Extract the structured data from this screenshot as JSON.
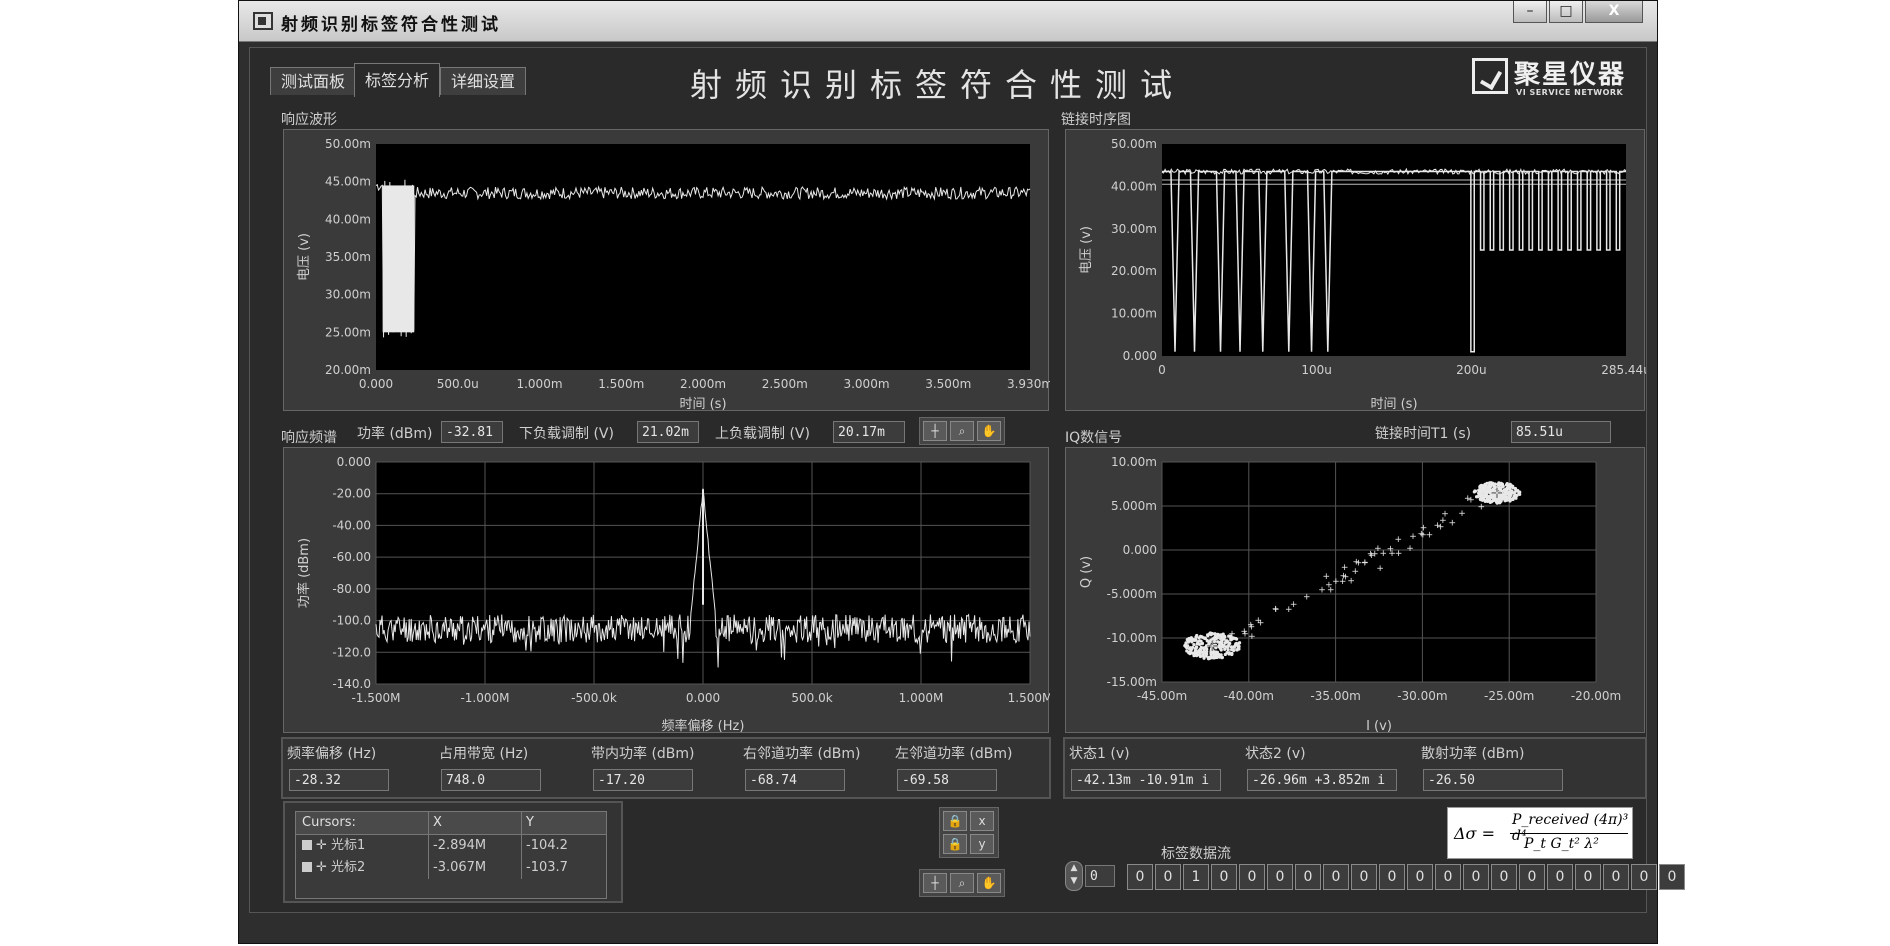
{
  "window": {
    "title": "射频识别标签符合性测试",
    "minimize_label": "–",
    "maximize_label": "□",
    "close_label": "X"
  },
  "tabs": [
    {
      "label": "测试面板",
      "active": false
    },
    {
      "label": "标签分析",
      "active": true
    },
    {
      "label": "详细设置",
      "active": false
    }
  ],
  "main_title": "射频识别标签符合性测试",
  "logo": {
    "text": "聚星仪器",
    "subtext": "VI SERVICE NETWORK"
  },
  "response_waveform": {
    "label": "响应波形",
    "chart_data": {
      "type": "line",
      "xlabel": "时间 (s)",
      "ylabel": "电压 (v)",
      "xlim": [
        0,
        0.00393
      ],
      "ylim": [
        0.02,
        0.05
      ],
      "x_ticks": [
        "0.000",
        "500.0u",
        "1.000m",
        "1.500m",
        "2.000m",
        "2.500m",
        "3.000m",
        "3.500m",
        "3.930m"
      ],
      "y_ticks": [
        "50.00m",
        "45.00m",
        "40.00m",
        "35.00m",
        "30.00m",
        "25.00m",
        "20.00m"
      ],
      "series": [
        {
          "x": [
            0,
            4e-05,
            4e-05,
            0.00023,
            0.00023,
            0.00393
          ],
          "y": [
            0.0445,
            0.0445,
            0.025,
            0.025,
            0.0435,
            0.0435
          ]
        }
      ],
      "grid": false
    }
  },
  "link_timing": {
    "label": "链接时序图",
    "chart_data": {
      "type": "line",
      "xlabel": "时间 (s)",
      "ylabel": "电压 (v)",
      "xlim": [
        0,
        0.00028544
      ],
      "ylim": [
        0,
        0.05
      ],
      "x_ticks": [
        "0",
        "100u",
        "200u",
        "285.44u"
      ],
      "y_ticks": [
        "50.00m",
        "40.00m",
        "30.00m",
        "20.00m",
        "10.00m",
        "0.000"
      ],
      "high_level": 0.0435,
      "reference_lines": [
        0.0415,
        0.0405
      ],
      "dip_times": [
        8e-06,
        2e-05,
        3.6e-05,
        4.8e-05,
        6.2e-05,
        7.8e-05,
        9.2e-05,
        0.000102
      ],
      "dip_level": 0.001,
      "burst_start": 0.00019,
      "burst_count": 16,
      "burst_low": 0.025,
      "grid": false
    }
  },
  "spectrum": {
    "label": "响应频谱",
    "chart_data": {
      "type": "line",
      "xlabel": "频率偏移 (Hz)",
      "ylabel": "功率 (dBm)",
      "xlim": [
        -1500000,
        1500000
      ],
      "ylim": [
        -140,
        0
      ],
      "x_ticks": [
        "-1.500M",
        "-1.000M",
        "-500.0k",
        "0.000",
        "500.0k",
        "1.000M",
        "1.500M"
      ],
      "y_ticks": [
        "0.000",
        "-20.00",
        "-40.00",
        "-60.00",
        "-80.00",
        "-100.0",
        "-120.0",
        "-140.0"
      ],
      "noise_floor": -105,
      "peak": {
        "x": 0,
        "y": -17.2
      },
      "grid": true
    }
  },
  "iq": {
    "label": "IQ数信号",
    "chart_data": {
      "type": "scatter",
      "xlabel": "I (v)",
      "ylabel": "Q (v)",
      "xlim": [
        -0.045,
        -0.02
      ],
      "ylim": [
        -0.015,
        0.01
      ],
      "x_ticks": [
        "-45.00m",
        "-40.00m",
        "-35.00m",
        "-30.00m",
        "-25.00m",
        "-20.00m"
      ],
      "y_ticks": [
        "10.00m",
        "5.000m",
        "0.000",
        "-5.000m",
        "-10.00m",
        "-15.00m"
      ],
      "clusters": [
        {
          "center": [
            -0.0421,
            -0.0109
          ],
          "spread": 0.0015
        },
        {
          "center": [
            -0.0257,
            0.0065
          ],
          "spread": 0.0012
        }
      ],
      "grid": true
    }
  },
  "spectrum_measurements": {
    "power_label": "功率 (dBm)",
    "power_value": "-32.81",
    "lower_mod_label": "下负载调制 (V)",
    "lower_mod_value": "21.02m",
    "upper_mod_label": "上负载调制 (V)",
    "upper_mod_value": "20.17m"
  },
  "link_time": {
    "label": "链接时间T1 (s)",
    "value": "85.51u"
  },
  "measurements": [
    {
      "label": "频率偏移 (Hz)",
      "value": "-28.32"
    },
    {
      "label": "占用带宽 (Hz)",
      "value": "748.0"
    },
    {
      "label": "带内功率 (dBm)",
      "value": "-17.20"
    },
    {
      "label": "右邻道功率 (dBm)",
      "value": "-68.74"
    },
    {
      "label": "左邻道功率 (dBm)",
      "value": "-69.58"
    }
  ],
  "iq_measurements": [
    {
      "label": "状态1 (v)",
      "value": "-42.13m -10.91m i"
    },
    {
      "label": "状态2 (v)",
      "value": "-26.96m +3.852m i"
    },
    {
      "label": "散射功率 (dBm)",
      "value": "-26.50"
    }
  ],
  "cursors": {
    "headers": [
      "Cursors:",
      "X",
      "Y"
    ],
    "rows": [
      {
        "name": "光标1",
        "x": "-2.894M",
        "y": "-104.2"
      },
      {
        "name": "光标2",
        "x": "-3.067M",
        "y": "-103.7"
      }
    ]
  },
  "bitstream": {
    "label": "标签数据流",
    "index": "0",
    "bits": [
      "0",
      "0",
      "1",
      "0",
      "0",
      "0",
      "0",
      "0",
      "0",
      "0",
      "0",
      "0",
      "0",
      "0",
      "0",
      "0",
      "0",
      "0",
      "0",
      "0"
    ]
  },
  "formula": {
    "lhs": "Δσ =",
    "numerator": "P_received (4π)³ d⁴",
    "denominator": "P_t G_t²      λ²"
  },
  "colors": {
    "plot_bg": "#000000",
    "trace": "#e8e8e8",
    "panel": "#2e2e2e"
  }
}
